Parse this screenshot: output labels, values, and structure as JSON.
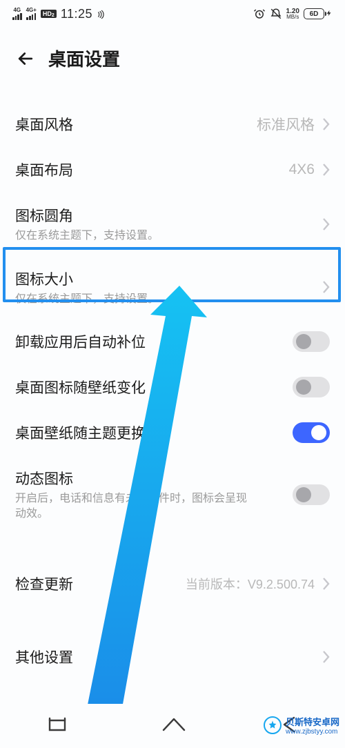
{
  "status_bar": {
    "signal1_label": "4G",
    "signal2_label": "4G+",
    "hd_label": "HD",
    "hd_sub": "2",
    "time": "11:25",
    "net_speed_value": "1.20",
    "net_speed_unit": "MB/s",
    "battery_text": "6D"
  },
  "header": {
    "title": "桌面设置"
  },
  "rows": {
    "style": {
      "label": "桌面风格",
      "value": "标准风格"
    },
    "layout": {
      "label": "桌面布局",
      "value": "4X6"
    },
    "corner": {
      "label": "图标圆角",
      "sub": "仅在系统主题下，支持设置。"
    },
    "size": {
      "label": "图标大小",
      "sub": "仅在系统主题下，支持设置。"
    },
    "autofill": {
      "label": "卸载应用后自动补位"
    },
    "iconwall": {
      "label": "桌面图标随壁纸变化"
    },
    "wallpaper": {
      "label": "桌面壁纸随主题更换"
    },
    "dynamic": {
      "label": "动态图标",
      "sub": "开启后，电话和信息有未读事件时，图标会呈现动效。"
    },
    "update": {
      "label": "检查更新",
      "value": "当前版本：V9.2.500.74"
    },
    "other": {
      "label": "其他设置"
    }
  },
  "toggles": {
    "autofill": false,
    "iconwall": false,
    "wallpaper": true,
    "dynamic": false
  },
  "watermark": {
    "brand": "贝斯特安卓网",
    "url": "www.zjbstyy.com"
  }
}
